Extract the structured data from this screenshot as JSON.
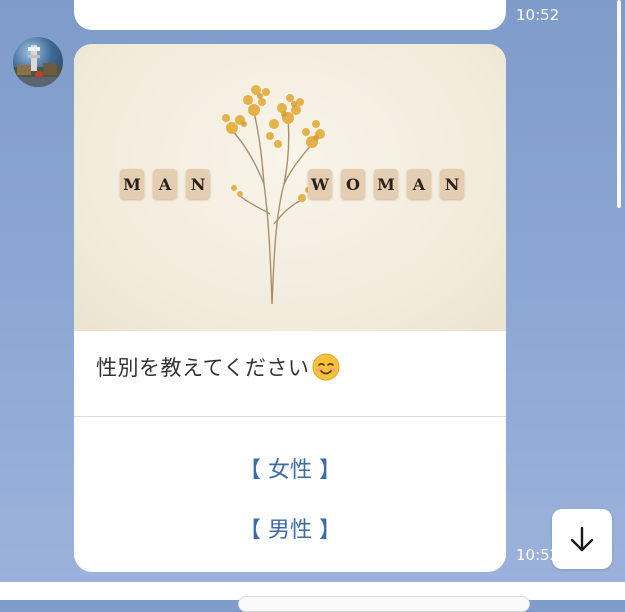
{
  "messages": {
    "previous": {
      "time": "10:52"
    },
    "card": {
      "image_words": {
        "man": [
          "M",
          "A",
          "N"
        ],
        "woman": [
          "W",
          "O",
          "M",
          "A",
          "N"
        ]
      },
      "text": "性別を教えてください",
      "emoji": "smiling-face-icon",
      "options": [
        {
          "label": "【 女性 】"
        },
        {
          "label": "【 男性 】"
        }
      ],
      "time": "10:52"
    }
  },
  "icons": {
    "scroll_down": "arrow-down-icon"
  },
  "colors": {
    "background": "#8aa5d2",
    "option_text": "#3d6aa8",
    "bubble": "#ffffff",
    "time_text": "#ffffff"
  }
}
